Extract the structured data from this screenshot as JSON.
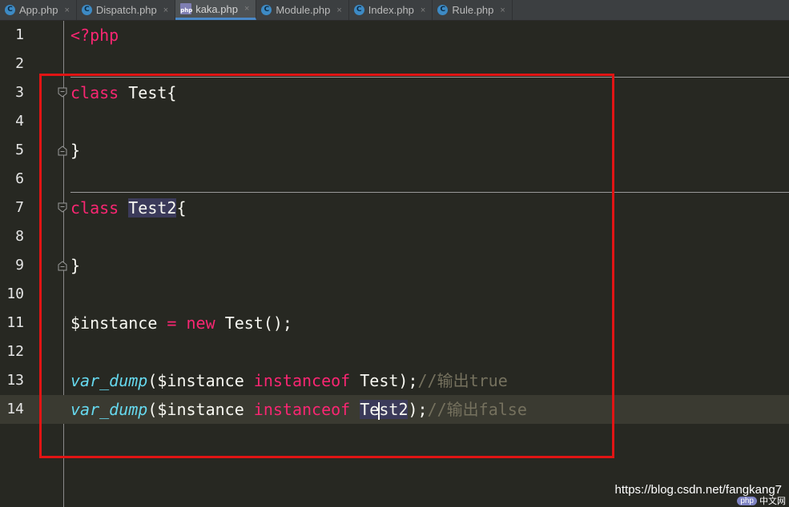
{
  "tabs": [
    {
      "label": "App.php",
      "icon": "C",
      "active": false
    },
    {
      "label": "Dispatch.php",
      "icon": "C",
      "active": false
    },
    {
      "label": "kaka.php",
      "icon": "php",
      "active": true
    },
    {
      "label": "Module.php",
      "icon": "C",
      "active": false
    },
    {
      "label": "Index.php",
      "icon": "C",
      "active": false
    },
    {
      "label": "Rule.php",
      "icon": "C",
      "active": false
    }
  ],
  "tab_close_glyph": "×",
  "lines": {
    "n1": "1",
    "n2": "2",
    "n3": "3",
    "n4": "4",
    "n5": "5",
    "n6": "6",
    "n7": "7",
    "n8": "8",
    "n9": "9",
    "n10": "10",
    "n11": "11",
    "n12": "12",
    "n13": "13",
    "n14": "14"
  },
  "code": {
    "l1_open": "<?php",
    "l3_kw": "class",
    "l3_name": "Test{",
    "l5_brace": "}",
    "l7_kw": "class",
    "l7_name": "Test2",
    "l7_brace": "{",
    "l9_brace": "}",
    "l11_var": "$instance",
    "l11_eq": "=",
    "l11_new": "new",
    "l11_rest": "Test();",
    "l13_fn": "var_dump",
    "l13_paren": "($instance",
    "l13_kw": "instanceof",
    "l13_cls": "Test);",
    "l13_cm": "//输出true",
    "l14_fn": "var_dump",
    "l14_paren": "($instance",
    "l14_kw": "instanceof",
    "l14_cls_a": "Te",
    "l14_cls_b": "st2",
    "l14_rest": ");",
    "l14_cm": "//输出false"
  },
  "watermark": {
    "url": "https://blog.csdn.net/fangkang7",
    "badge": "php",
    "site": "中文网"
  },
  "colors": {
    "background": "#272822",
    "keyword": "#f92672",
    "function": "#66d9ef",
    "comment": "#75715e",
    "annotation_box": "#e11414"
  }
}
